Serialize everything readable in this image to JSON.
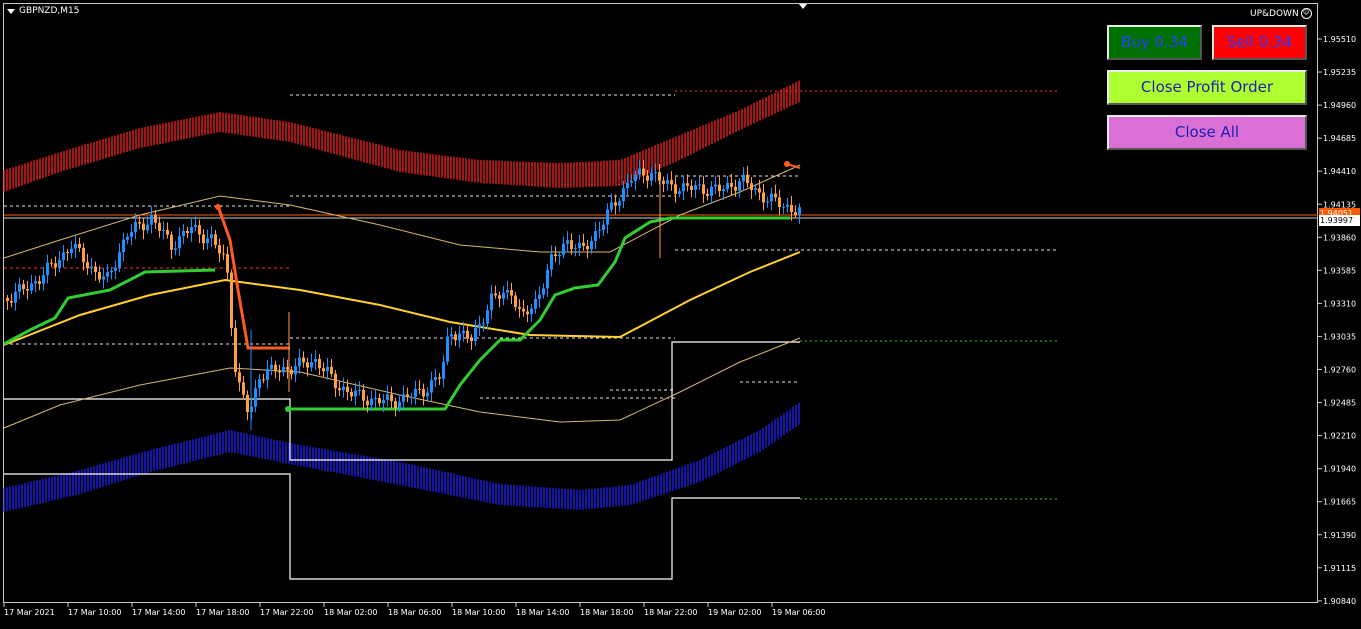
{
  "window": {
    "symbol_title": "GBPNZD,M15",
    "indicator_label": "UP&DOWN",
    "indicator_icon": "smiley-icon"
  },
  "buttons": {
    "buy_label": "Buy 0.34",
    "sell_label": "Sell 0.34",
    "close_profit_label": "Close Profit Order",
    "close_all_label": "Close All"
  },
  "price_axis": {
    "labels": [
      "1.95510",
      "1.95235",
      "1.94960",
      "1.94685",
      "1.94410",
      "1.94135",
      "1.93860",
      "1.93585",
      "1.93310",
      "1.93035",
      "1.92760",
      "1.92485",
      "1.92210",
      "1.91940",
      "1.91665",
      "1.91390",
      "1.91115",
      "1.90840"
    ],
    "bid_tag": "1.94051",
    "ask_tag": "1.93997"
  },
  "time_axis": {
    "labels": [
      "17 Mar 2021",
      "17 Mar 10:00",
      "17 Mar 14:00",
      "17 Mar 18:00",
      "17 Mar 22:00",
      "18 Mar 02:00",
      "18 Mar 06:00",
      "18 Mar 10:00",
      "18 Mar 14:00",
      "18 Mar 18:00",
      "18 Mar 22:00",
      "19 Mar 02:00",
      "19 Mar 06:00"
    ]
  },
  "colors": {
    "background": "#000000",
    "bull_candle": "#1e90ff",
    "bear_candle": "#ffa040",
    "upper_band": "#ff2020",
    "lower_band": "#2020ff",
    "trailing_stop": "#32cd32",
    "trailing_stop_down": "#ff5a1e",
    "slow_ma": "#ffd030",
    "envelope_ma": "#d8b870",
    "buy_button": "#007000",
    "sell_button": "#ff0000",
    "close_profit_button": "#adff2f",
    "close_all_button": "#da70d6"
  }
}
